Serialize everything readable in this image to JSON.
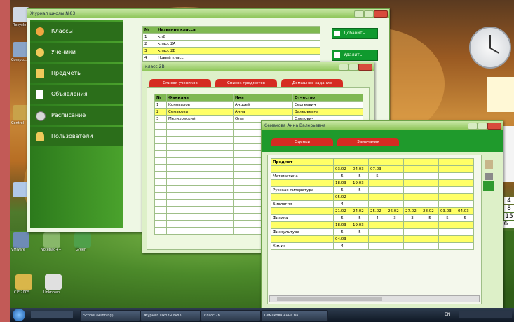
{
  "window1": {
    "title": "Журнал школы №83",
    "menu": [
      {
        "label": "Классы",
        "icon": "classes-icon"
      },
      {
        "label": "Ученики",
        "icon": "students-icon"
      },
      {
        "label": "Предметы",
        "icon": "subjects-icon"
      },
      {
        "label": "Объявления",
        "icon": "announcements-icon"
      },
      {
        "label": "Расписание",
        "icon": "schedule-icon"
      },
      {
        "label": "Пользователи",
        "icon": "users-icon"
      }
    ],
    "table_headers": [
      "№",
      "Название класса"
    ],
    "rows": [
      [
        "1",
        "кл2"
      ],
      [
        "2",
        "класс 2А"
      ],
      [
        "3",
        "класс 2В"
      ],
      [
        "4",
        "Новый класс"
      ]
    ],
    "add_button": "Добавить",
    "delete_button": "Удалить"
  },
  "window2": {
    "title": "класс 2В",
    "tabs": [
      "Список учеников",
      "Список предметов",
      "Домашнее задание"
    ],
    "headers": [
      "№",
      "Фамилия",
      "Имя",
      "Отчество"
    ],
    "rows": [
      [
        "1",
        "Коновалов",
        "Андрей",
        "Сергеевич"
      ],
      [
        "2",
        "Семакова",
        "Анна",
        "Валерьевна"
      ],
      [
        "3",
        "Мелиховский",
        "Олег",
        "Олегович"
      ]
    ]
  },
  "window3": {
    "title": "Семакова Анна Валерьевна",
    "tabs": [
      "Оценки",
      "Замечания"
    ],
    "subject_header": "Предмет",
    "grades": [
      {
        "subject": "Математика",
        "dates": [
          "03.02",
          "04.03",
          "07.03"
        ],
        "marks": [
          "5",
          "5",
          "5"
        ]
      },
      {
        "subject": "Русская литература",
        "dates": [
          "18.03",
          "19.03"
        ],
        "marks": [
          "5",
          "5"
        ]
      },
      {
        "subject": "Биология",
        "dates": [
          "05.02"
        ],
        "marks": [
          "4"
        ]
      },
      {
        "subject": "Физика",
        "dates": [
          "21.02",
          "24.02",
          "25.02",
          "26.02",
          "27.02",
          "28.02",
          "03.03",
          "04.03"
        ],
        "marks": [
          "5",
          "5",
          "4",
          "3",
          "3",
          "5",
          "5",
          "5"
        ]
      },
      {
        "subject": "Физкультура",
        "dates": [
          "18.03",
          "19.03"
        ],
        "marks": [
          "5",
          "5"
        ]
      },
      {
        "subject": "Химия",
        "dates": [
          "04.03"
        ],
        "marks": [
          "4"
        ]
      }
    ]
  },
  "desktop": {
    "icons": [
      {
        "label": "Recycle",
        "color": "#cfd8e4"
      },
      {
        "label": "Compu...",
        "color": "#8aa4c8"
      },
      {
        "label": "Control",
        "color": "#c8a24a"
      },
      {
        "label": "Ads",
        "color": "#b0c8e8"
      },
      {
        "label": "VMware",
        "color": "#6e8bb5"
      },
      {
        "label": "Notepad++",
        "color": "#88b86a"
      },
      {
        "label": "Green",
        "color": "#4fa04a"
      },
      {
        "label": "CIF 2005",
        "color": "#d9b64a"
      },
      {
        "label": "Unknown",
        "color": "#e0e0e0"
      }
    ],
    "calendar_days": [
      "3",
      "4",
      "7",
      "8",
      "14",
      "15",
      "16"
    ]
  },
  "taskbar": {
    "items": [
      "School (Running)",
      "Журнал школы №83",
      "класс 2В",
      "Семакова Анна Ва..."
    ],
    "lang": "EN"
  }
}
